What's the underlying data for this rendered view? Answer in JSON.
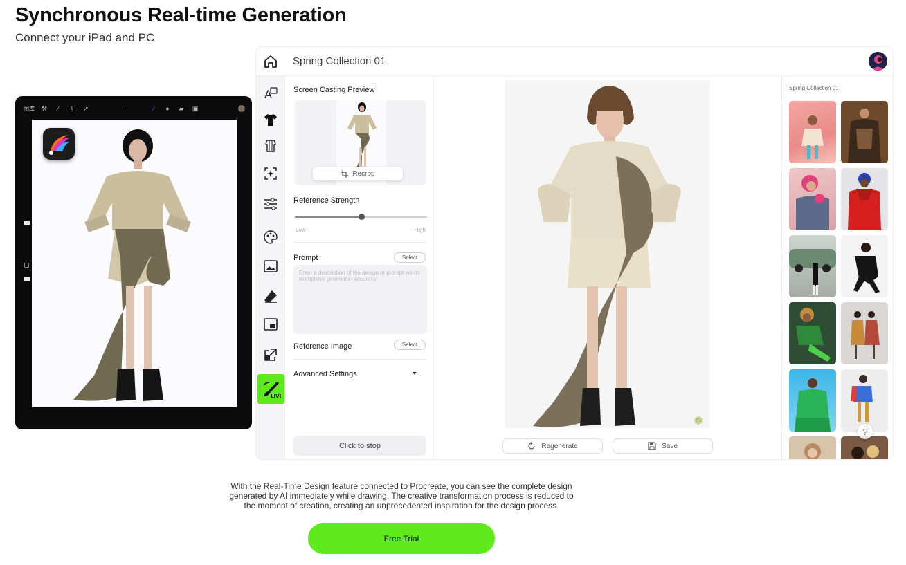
{
  "hero": {
    "title": "Synchronous Real-time Generation",
    "subtitle": "Connect your iPad and PC"
  },
  "ipad": {
    "toolbar_label": "图库"
  },
  "app": {
    "project_title": "Spring Collection 01",
    "rail_icons": [
      "text-style-icon",
      "tshirt-icon",
      "garment-icon",
      "ai-frame-icon",
      "sliders-icon",
      "palette-icon",
      "image-icon",
      "eraser-icon",
      "picture-in-picture-icon",
      "expand-icon",
      "live-brush-icon"
    ],
    "live_badge": "LIVE",
    "panel": {
      "screen_cast_heading": "Screen Casting Preview",
      "recrop_label": "Recrop",
      "reference_strength_heading": "Reference Strength",
      "slider_low": "Low",
      "slider_high": "High",
      "reference_strength_value": 0.5,
      "prompt_heading": "Prompt",
      "prompt_select": "Select",
      "prompt_placeholder": "Enter a description of the design or prompt words to improve generation accuracy",
      "reference_image_heading": "Reference Image",
      "reference_select": "Select",
      "advanced_settings": "Advanced Settings",
      "stop_label": "Click to stop"
    },
    "canvas": {
      "regenerate_label": "Regenerate",
      "save_label": "Save"
    },
    "gallery": {
      "title": "Spring Collection 01",
      "help": "?"
    }
  },
  "description": "With the Real-Time Design feature connected to Procreate, you can see the complete design generated by AI immediately while drawing. The creative transformation process is reduced to the moment of creation, creating an unprecedented inspiration for the design process.",
  "cta": "Free Trial",
  "colors": {
    "accent": "#5eea1d",
    "ipad_frame": "#0b0b0b",
    "rail_bg": "#f5f5f7"
  }
}
